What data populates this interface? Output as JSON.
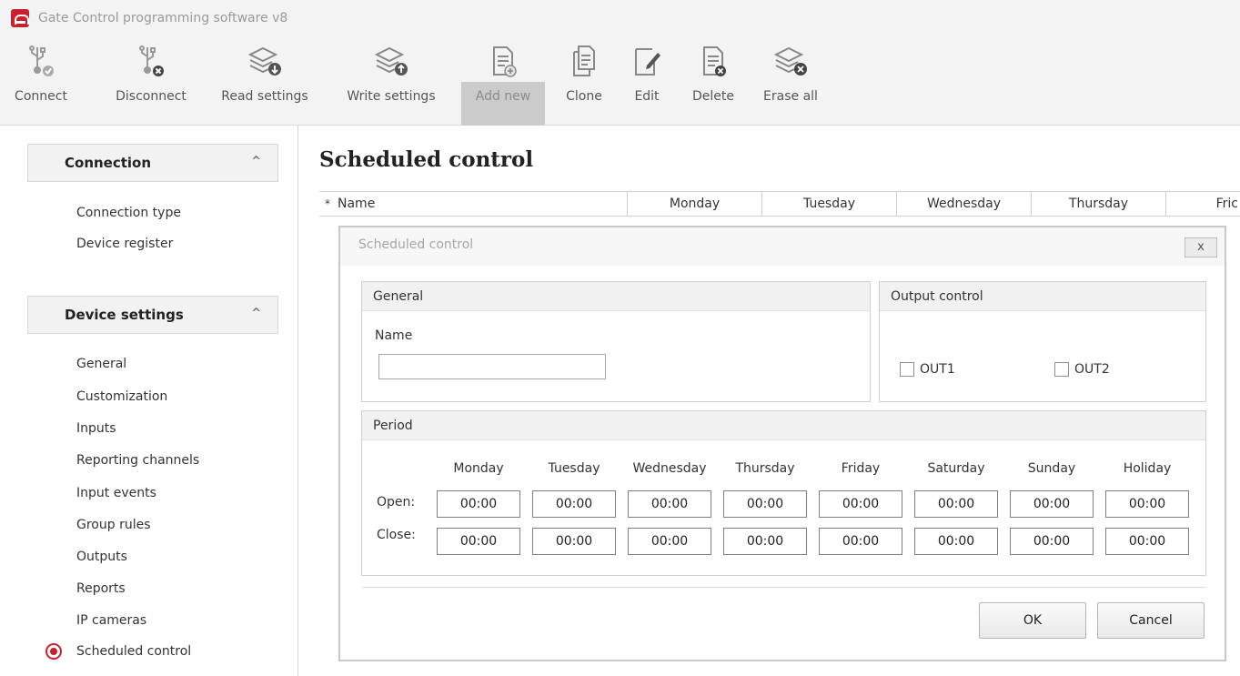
{
  "window": {
    "title": "Gate Control programming software v8"
  },
  "toolbar": {
    "connect": "Connect",
    "disconnect": "Disconnect",
    "read_settings": "Read settings",
    "write_settings": "Write settings",
    "add_new": "Add new",
    "clone": "Clone",
    "edit": "Edit",
    "delete": "Delete",
    "erase_all": "Erase all"
  },
  "sidebar": {
    "connection_group": {
      "label": "Connection",
      "items": [
        "Connection type",
        "Device register"
      ]
    },
    "device_group": {
      "label": "Device settings",
      "items": [
        "General",
        "Customization",
        "Inputs",
        "Reporting channels",
        "Input events",
        "Group rules",
        "Outputs",
        "Reports",
        "IP cameras",
        "Scheduled control"
      ]
    }
  },
  "main": {
    "title": "Scheduled control",
    "grid": {
      "star": "*",
      "columns": [
        "Name",
        "Monday",
        "Tuesday",
        "Wednesday",
        "Thursday",
        "Fric"
      ]
    }
  },
  "dialog": {
    "title": "Scheduled control",
    "close": "x",
    "general": {
      "header": "General",
      "name_label": "Name",
      "name_value": ""
    },
    "output_control": {
      "header": "Output control",
      "out1": "OUT1",
      "out2": "OUT2"
    },
    "period": {
      "header": "Period",
      "days": [
        "Monday",
        "Tuesday",
        "Wednesday",
        "Thursday",
        "Friday",
        "Saturday",
        "Sunday",
        "Holiday"
      ],
      "open_label": "Open:",
      "close_label": "Close:",
      "open_times": [
        "00:00",
        "00:00",
        "00:00",
        "00:00",
        "00:00",
        "00:00",
        "00:00",
        "00:00"
      ],
      "close_times": [
        "00:00",
        "00:00",
        "00:00",
        "00:00",
        "00:00",
        "00:00",
        "00:00",
        "00:00"
      ]
    },
    "ok": "OK",
    "cancel": "Cancel"
  }
}
